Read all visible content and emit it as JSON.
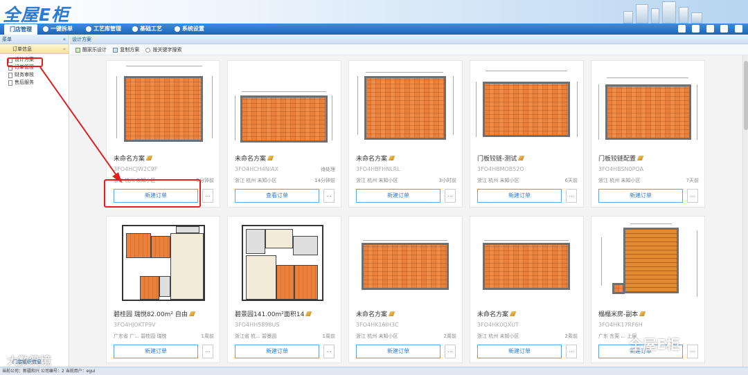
{
  "app": {
    "logo_text": "全屋E柜"
  },
  "nav": {
    "tabs": [
      "门店管理",
      "一键拆单",
      "工艺库管理",
      "基础工艺",
      "系统设置"
    ],
    "active": 0
  },
  "left": {
    "header": "菜单",
    "collapse_glyph": "«",
    "group": "订单信息",
    "group_glyph": "«",
    "items": [
      "设计方案",
      "订单管理",
      "财务审核",
      "售后服务"
    ],
    "selected": 0
  },
  "main": {
    "title": "设计方案",
    "toolbar": [
      "酷家乐设计",
      "复制方案",
      "按关键字搜索"
    ]
  },
  "cards": [
    {
      "name": "未命名方案",
      "code": "3FO4HCJW2C9F",
      "status": "",
      "addr": "浙江 杭州 未知小区",
      "time": "5分钟前",
      "button": "新建订单"
    },
    {
      "name": "未命名方案",
      "code": "3FO4HCH4NIAX",
      "status": "待处理",
      "addr": "浙江 杭州 未知小区",
      "time": "14分钟前",
      "button": "查看订单"
    },
    {
      "name": "未命名方案",
      "code": "3FO4HBFHNLRL",
      "status": "",
      "addr": "浙江 杭州 未知小区",
      "time": "3小时前",
      "button": "新建订单"
    },
    {
      "name": "门板铰链-测试",
      "code": "3FO4HBMOB52O",
      "status": "",
      "addr": "浙江 杭州 未知小区",
      "time": "6天前",
      "button": "新建订单"
    },
    {
      "name": "门板铰链配置",
      "code": "3FO4HBSN0POA",
      "status": "",
      "addr": "浙江 杭州 未知小区",
      "time": "7天前",
      "button": "新建订单"
    },
    {
      "name": "碧桂园 瑞悦82.00m² 自由",
      "code": "3FO4HJOKTP9V",
      "status": "",
      "addr": "广东省 广... 碧桂园 瑞悦",
      "time": "1周前",
      "button": "新建订单"
    },
    {
      "name": "碧景园141.00m²面积14",
      "code": "3FO4HH5898US",
      "status": "",
      "addr": "浙江省 杭... 碧景园",
      "time": "1周前",
      "button": "新建订单"
    },
    {
      "name": "未命名方案",
      "code": "3FO4HK16IH3C",
      "status": "",
      "addr": "浙江 杭州 未知小区",
      "time": "2周前",
      "button": "新建订单"
    },
    {
      "name": "未命名方案",
      "code": "3FO4HK0QXUT",
      "status": "",
      "addr": "浙江 杭州 未知小区",
      "time": "2周前",
      "button": "新建订单"
    },
    {
      "name": "榻榻米房-副本",
      "code": "3FO4HK17RF6H",
      "status": "",
      "addr": "广东 东莞 ... 上层",
      "time": "",
      "button": "新建订单"
    }
  ],
  "more_glyph": "...",
  "status_bar": "当前公司：新疆和兴   公司编号：2   当前用户：egui",
  "watermarks": {
    "left": "大数筑境",
    "left_sub": "门店组织信息",
    "right": "全屋E柜"
  },
  "colors": {
    "nav": "#1e64b8",
    "accent": "#2a7cd2",
    "highlight": "#e02020",
    "floor": "#e9813d"
  }
}
